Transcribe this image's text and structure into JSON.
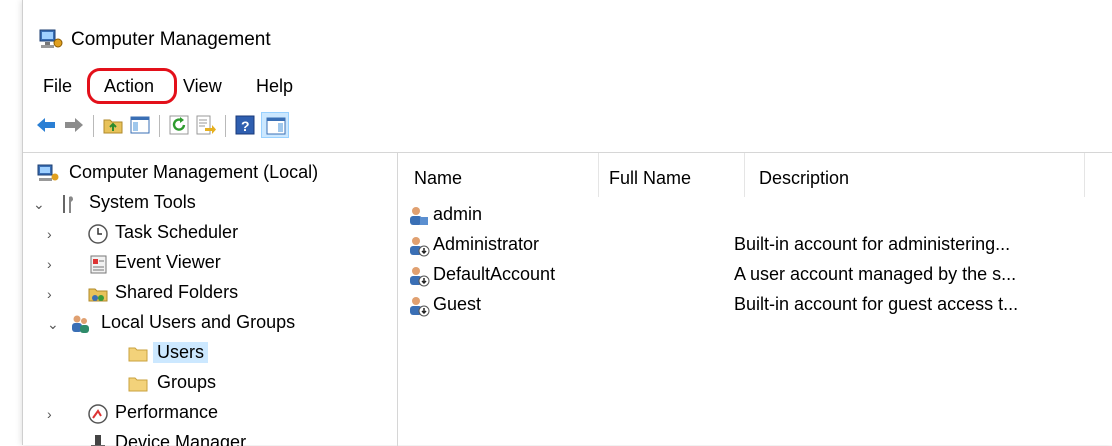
{
  "window": {
    "title": "Computer Management"
  },
  "menu": {
    "file": "File",
    "action": "Action",
    "view": "View",
    "help": "Help"
  },
  "toolbar": {
    "buttons": [
      "back-icon",
      "forward-icon",
      "up-folder-icon",
      "show-hide-console-tree-icon",
      "refresh-icon",
      "export-list-icon",
      "help-icon",
      "show-hide-action-pane-icon"
    ]
  },
  "tree": {
    "root": "Computer Management (Local)",
    "system_tools": "System Tools",
    "task_scheduler": "Task Scheduler",
    "event_viewer": "Event Viewer",
    "shared_folders": "Shared Folders",
    "local_users_groups": "Local Users and Groups",
    "users": "Users",
    "groups": "Groups",
    "performance": "Performance",
    "device_manager": "Device Manager"
  },
  "list": {
    "columns": {
      "name": "Name",
      "full_name": "Full Name",
      "description": "Description"
    },
    "rows": [
      {
        "name": "admin",
        "full_name": "",
        "description": ""
      },
      {
        "name": "Administrator",
        "full_name": "",
        "description": "Built-in account for administering..."
      },
      {
        "name": "DefaultAccount",
        "full_name": "",
        "description": "A user account managed by the s..."
      },
      {
        "name": "Guest",
        "full_name": "",
        "description": "Built-in account for guest access t..."
      }
    ]
  },
  "colors": {
    "highlight": "#e3101a",
    "selection": "#cce8ff"
  }
}
